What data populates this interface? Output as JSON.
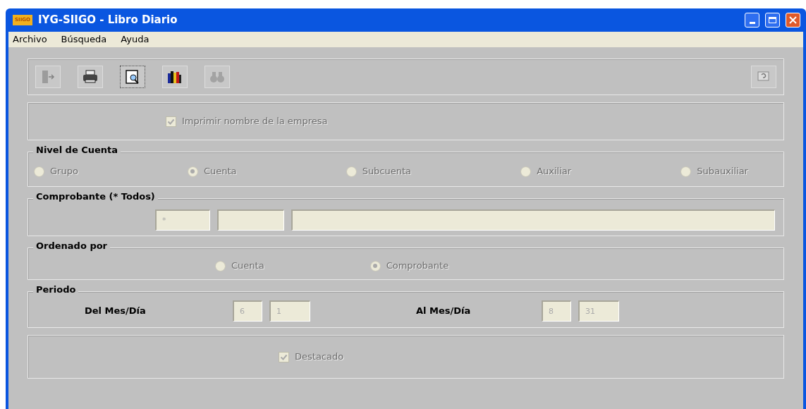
{
  "window": {
    "title": "IYG-SIIGO - Libro Diario",
    "logo": "SIIGO"
  },
  "menu": [
    {
      "label": "Archivo"
    },
    {
      "label": "Búsqueda"
    },
    {
      "label": "Ayuda"
    }
  ],
  "toolbar": [
    {
      "kind": "exit",
      "disabled": false
    },
    {
      "kind": "print",
      "disabled": false
    },
    {
      "kind": "preview",
      "disabled": false
    },
    {
      "kind": "books",
      "disabled": false
    },
    {
      "kind": "find",
      "disabled": true
    }
  ],
  "help_button": {
    "disabled": false
  },
  "company_name": {
    "label": "Imprimir nombre de la empresa",
    "checked": true,
    "disabled": true
  },
  "account_level": {
    "title": "Nivel de Cuenta",
    "options": [
      {
        "label": "Grupo",
        "selected": false,
        "disabled": true
      },
      {
        "label": "Cuenta",
        "selected": true,
        "disabled": true
      },
      {
        "label": "Subcuenta",
        "selected": false,
        "disabled": true
      },
      {
        "label": "Auxiliar",
        "selected": false,
        "disabled": true
      },
      {
        "label": "Subauxiliar",
        "selected": false,
        "disabled": true
      }
    ]
  },
  "voucher": {
    "title": "Comprobante (* Todos)",
    "type_value": "*",
    "disabled": true
  },
  "order_by": {
    "title": "Ordenado por",
    "options": [
      {
        "label": "Cuenta",
        "selected": false,
        "disabled": true
      },
      {
        "label": "Comprobante",
        "selected": true,
        "disabled": true
      }
    ]
  },
  "period": {
    "title": "Periodo",
    "from_label": "Del Mes/Día",
    "from_month": "6",
    "from_day": "1",
    "to_label": "Al Mes/Día",
    "to_month": "8",
    "to_day": "31",
    "disabled": true
  },
  "highlighted": {
    "label": "Destacado",
    "checked": true,
    "disabled": true
  }
}
